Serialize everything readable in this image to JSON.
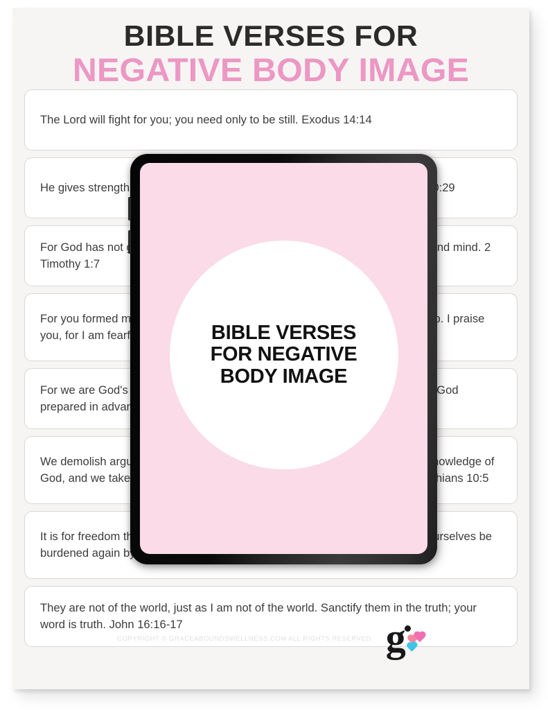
{
  "page": {
    "background_color": "#f6f5f3",
    "accent_pink": "#ec97c4",
    "screen_pink": "#fadbe7",
    "text_color": "#3c3c3c"
  },
  "heading": {
    "line1": "BIBLE VERSES FOR",
    "line2": "NEGATIVE BODY IMAGE"
  },
  "verses": [
    {
      "text": "The Lord will fight for you; you need only to be still. Exodus 14:14"
    },
    {
      "text": "He gives strength to the weary and increases the power of the weak. Isaiah 40:29"
    },
    {
      "text": "For God has not given us a spirit of fear, but of power and of love and of a sound mind. 2 Timothy 1:7"
    },
    {
      "text": "For you formed my inward parts; you knitted me together in my mother's womb. I praise you, for I am fearfully and wonderfully made. Psalm 139:13-14"
    },
    {
      "text": "For we are God's handiwork, created in Christ Jesus to do good works, which God prepared in advance for us to do. Ephesians 2:10"
    },
    {
      "text": "We demolish arguments and every pretension that sets itself up against the knowledge of God, and we take captive every thought to make it obedient to Christ. 2 Corinthians 10:5"
    },
    {
      "text": "It is for freedom that Christ has set us free. Stand firm, then, and do not let yourselves be burdened again by a yoke of slavery. Galatians 5:1"
    },
    {
      "text": "They are not of the world, just as I am not of the world. Sanctify them in the truth; your word is truth. John 16:16-17"
    }
  ],
  "tablet": {
    "screen_title_lines": [
      "BIBLE VERSES",
      "FOR NEGATIVE",
      "BODY IMAGE"
    ]
  },
  "footer": {
    "copyright": "COPYRIGHT © GRACEABOUNDSWELLNESS.COM ALL RIGHTS RESERVED.",
    "logo_letter": "g"
  }
}
